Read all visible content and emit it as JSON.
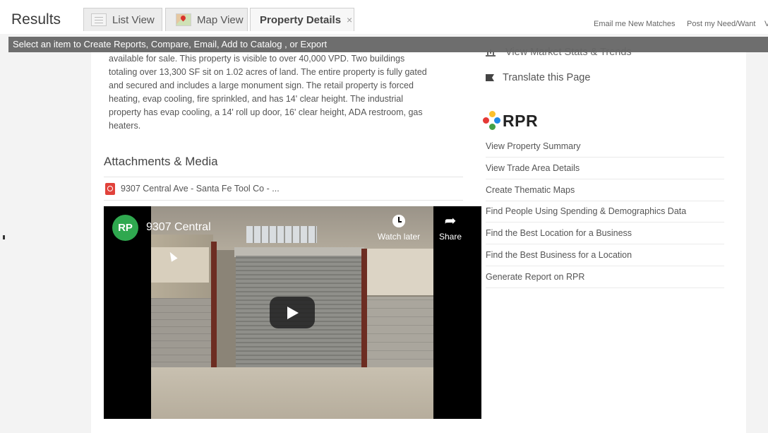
{
  "header": {
    "title": "Results",
    "tabs": [
      {
        "label": "List View",
        "icon": "list-view-icon"
      },
      {
        "label": "Map View",
        "icon": "map-view-icon"
      },
      {
        "label": "Property Details",
        "close": "×",
        "active": true
      }
    ],
    "links": {
      "email_matches": "Email me New Matches",
      "post_need": "Post my Need/Want",
      "truncated": "V"
    }
  },
  "instruction_bar": {
    "text": "Select an item to Create Reports, Compare, Email, Add to Catalog , or Export"
  },
  "description": {
    "lines": [
      "available for sale. This property is visible to over 40,000 VPD. Two buildings",
      "totaling over 13,300 SF sit on 1.02 acres of land. The entire property is fully gated",
      "and secured and includes a large monument sign. The retail property is forced",
      "heating, evap cooling, fire sprinkled, and has 14' clear height. The industrial",
      "property has evap cooling, a 14' roll up door, 16' clear height, ADA restroom, gas",
      "heaters."
    ]
  },
  "attachments": {
    "title": "Attachments & Media",
    "file_name": "9307 Central Ave - Santa Fe Tool Co - ..."
  },
  "video": {
    "channel_initials": "RP",
    "title": "9307 Central",
    "watch_later": "Watch later",
    "share": "Share"
  },
  "right_column": {
    "market_stats": "View Market Stats & Trends",
    "translate": "Translate this Page",
    "rpr_logo_text": "RPR",
    "rpr_colors": [
      "#e53935",
      "#fbc02d",
      "#43a047",
      "#1e88e5"
    ],
    "rpr_links": [
      "View Property Summary",
      "View Trade Area Details",
      "Create Thematic Maps",
      "Find People Using Spending & Demographics Data",
      "Find the Best Location for a Business",
      "Find the Best Business for a Location",
      "Generate Report on RPR"
    ]
  }
}
